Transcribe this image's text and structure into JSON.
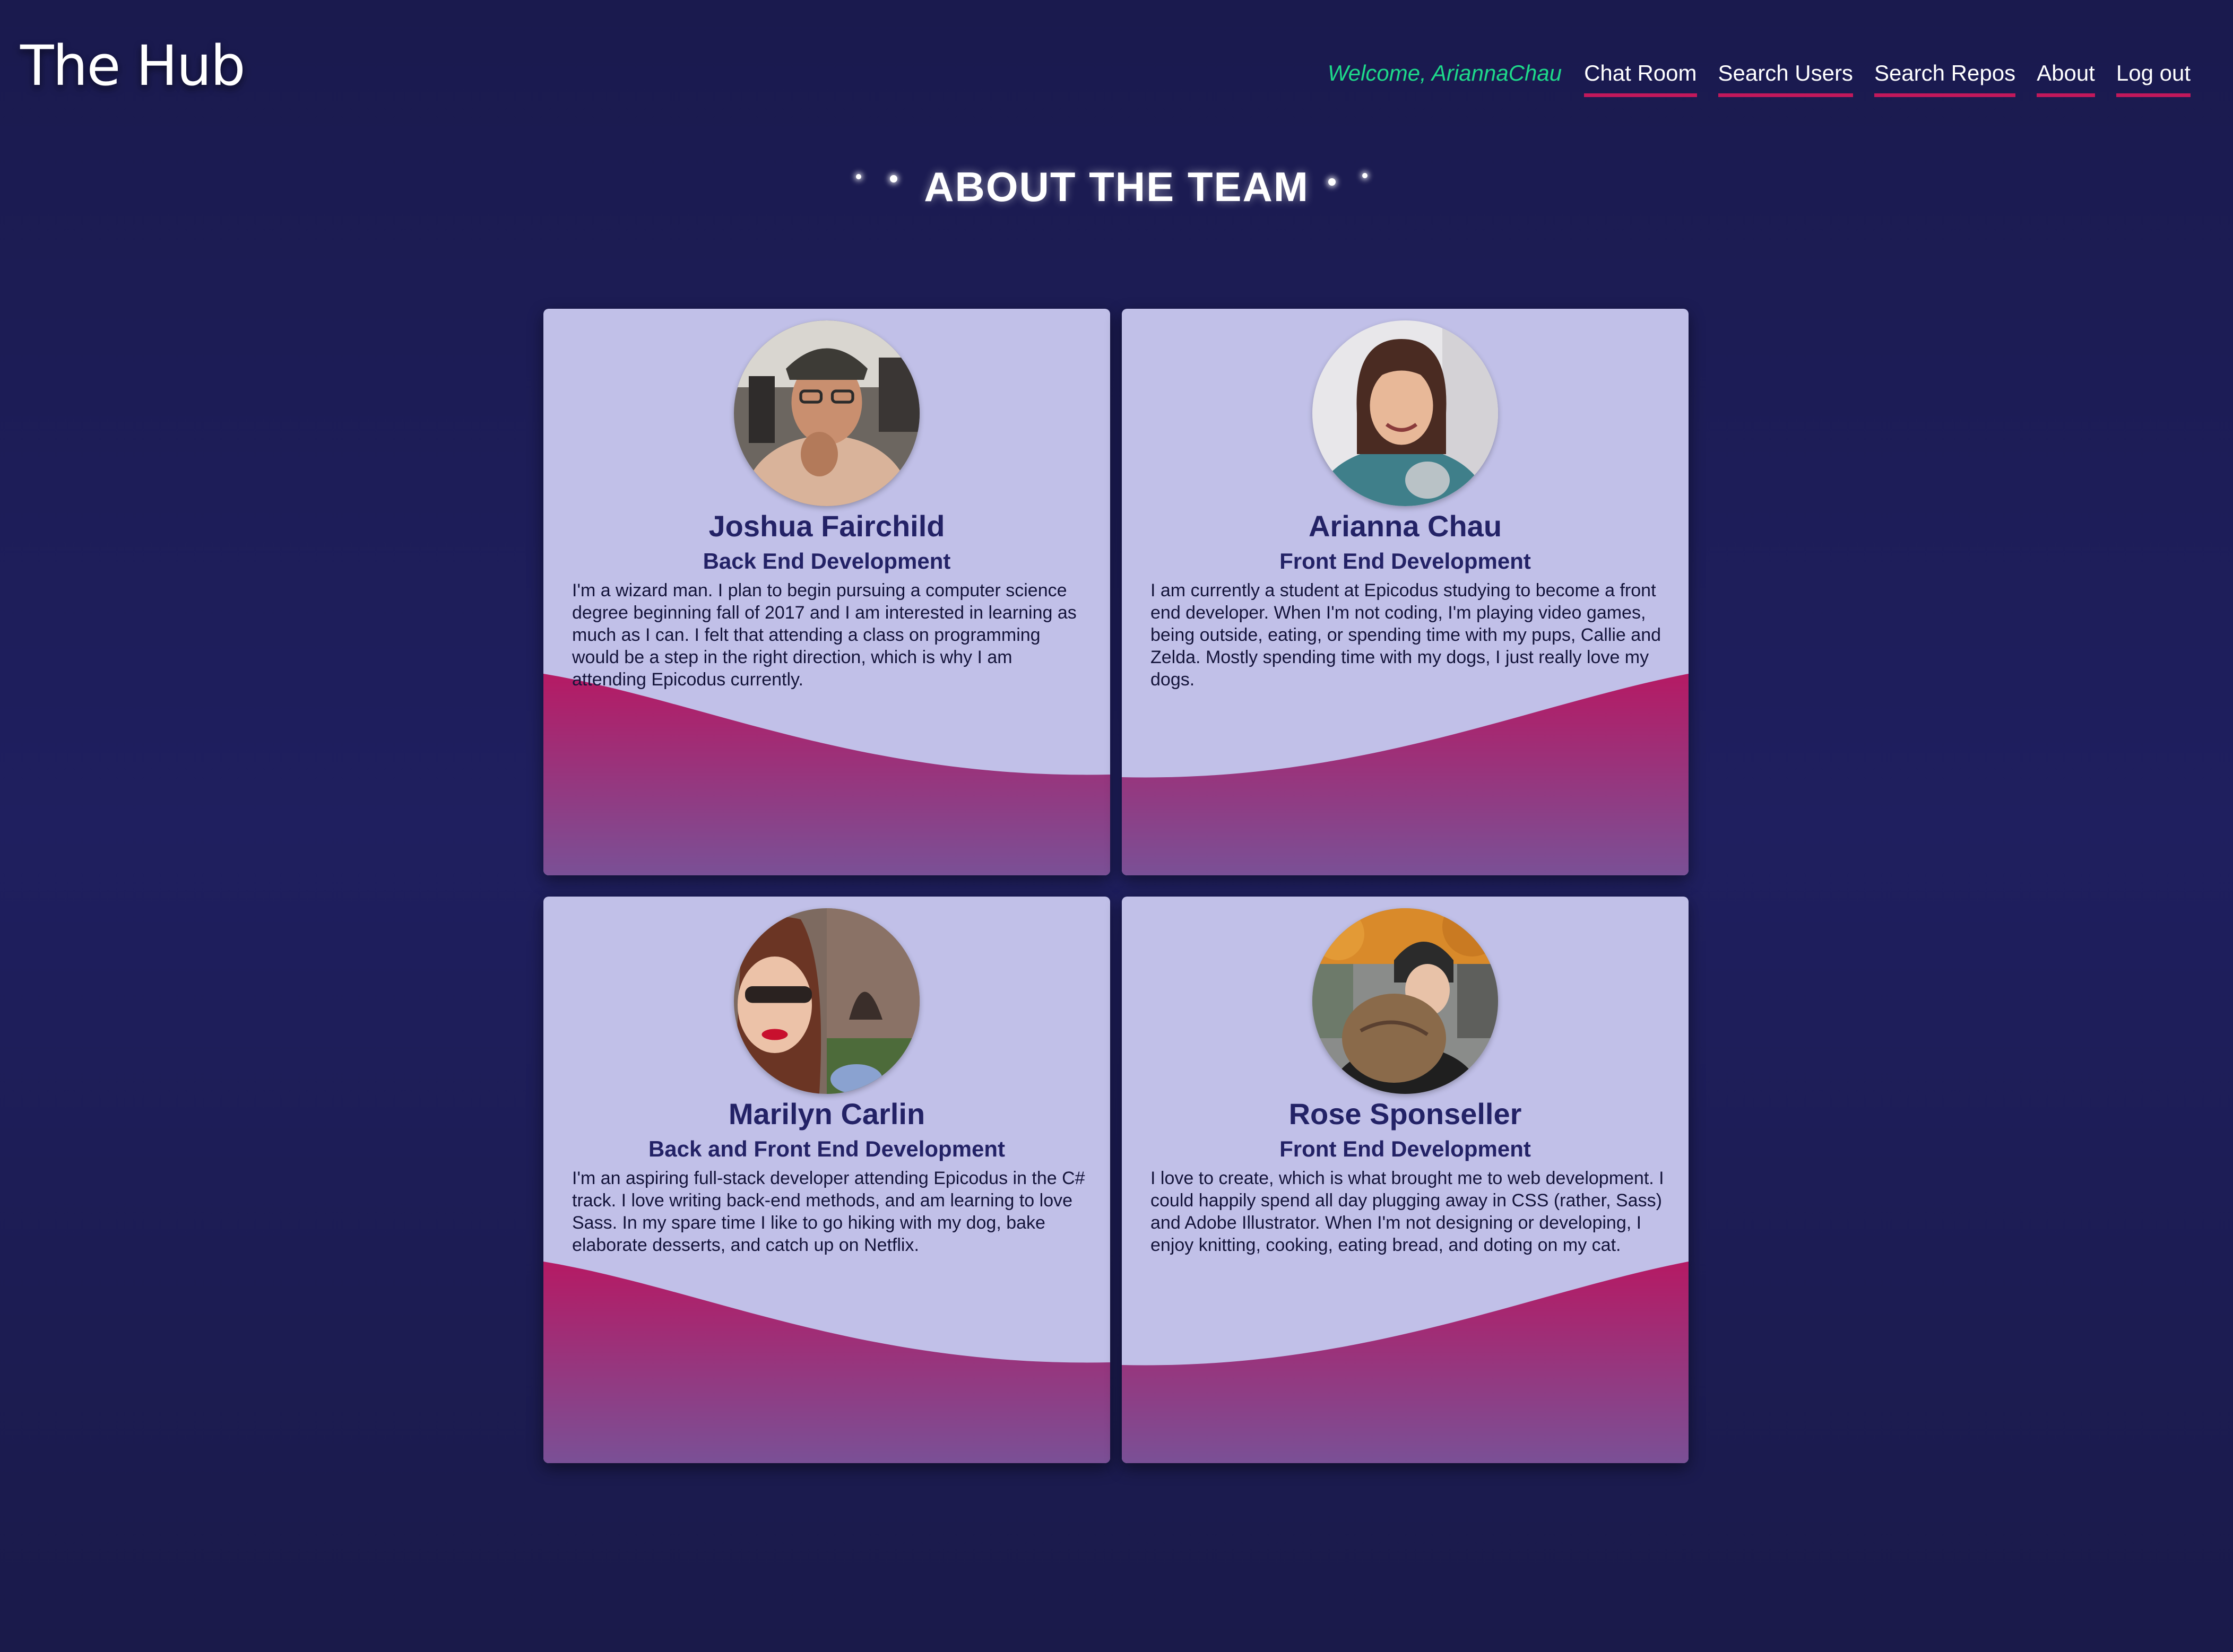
{
  "header": {
    "brand": "The Hub",
    "welcome": "Welcome, AriannaChau",
    "nav": [
      "Chat Room",
      "Search Users",
      "Search Repos",
      "About",
      "Log out"
    ]
  },
  "page_title": "ABOUT THE TEAM",
  "colors": {
    "background": "#1c1c52",
    "card": "#c1c0e8",
    "accent": "#c2185b",
    "welcome": "#1ed98a",
    "heading_text": "#232266"
  },
  "team": [
    {
      "name": "Joshua Fairchild",
      "role": "Back End Development",
      "bio": "I'm a wizard man. I plan to begin pursuing a computer science degree beginning fall of 2017 and I am interested in learning as much as I can. I felt that attending a class on programming would be a step in the right direction, which is why I am attending Epicodus currently."
    },
    {
      "name": "Arianna Chau",
      "role": "Front End Development",
      "bio": "I am currently a student at Epicodus studying to become a front end developer. When I'm not coding, I'm playing video games, being outside, eating, or spending time with my pups, Callie and Zelda. Mostly spending time with my dogs, I just really love my dogs."
    },
    {
      "name": "Marilyn Carlin",
      "role": "Back and Front End Development",
      "bio": "I'm an aspiring full-stack developer attending Epicodus in the C# track. I love writing back-end methods, and am learning to love Sass. In my spare time I like to go hiking with my dog, bake elaborate desserts, and catch up on Netflix."
    },
    {
      "name": "Rose Sponseller",
      "role": "Front End Development",
      "bio": "I love to create, which is what brought me to web development. I could happily spend all day plugging away in CSS (rather, Sass) and Adobe Illustrator. When I'm not designing or developing, I enjoy knitting, cooking, eating bread, and doting on my cat."
    }
  ]
}
